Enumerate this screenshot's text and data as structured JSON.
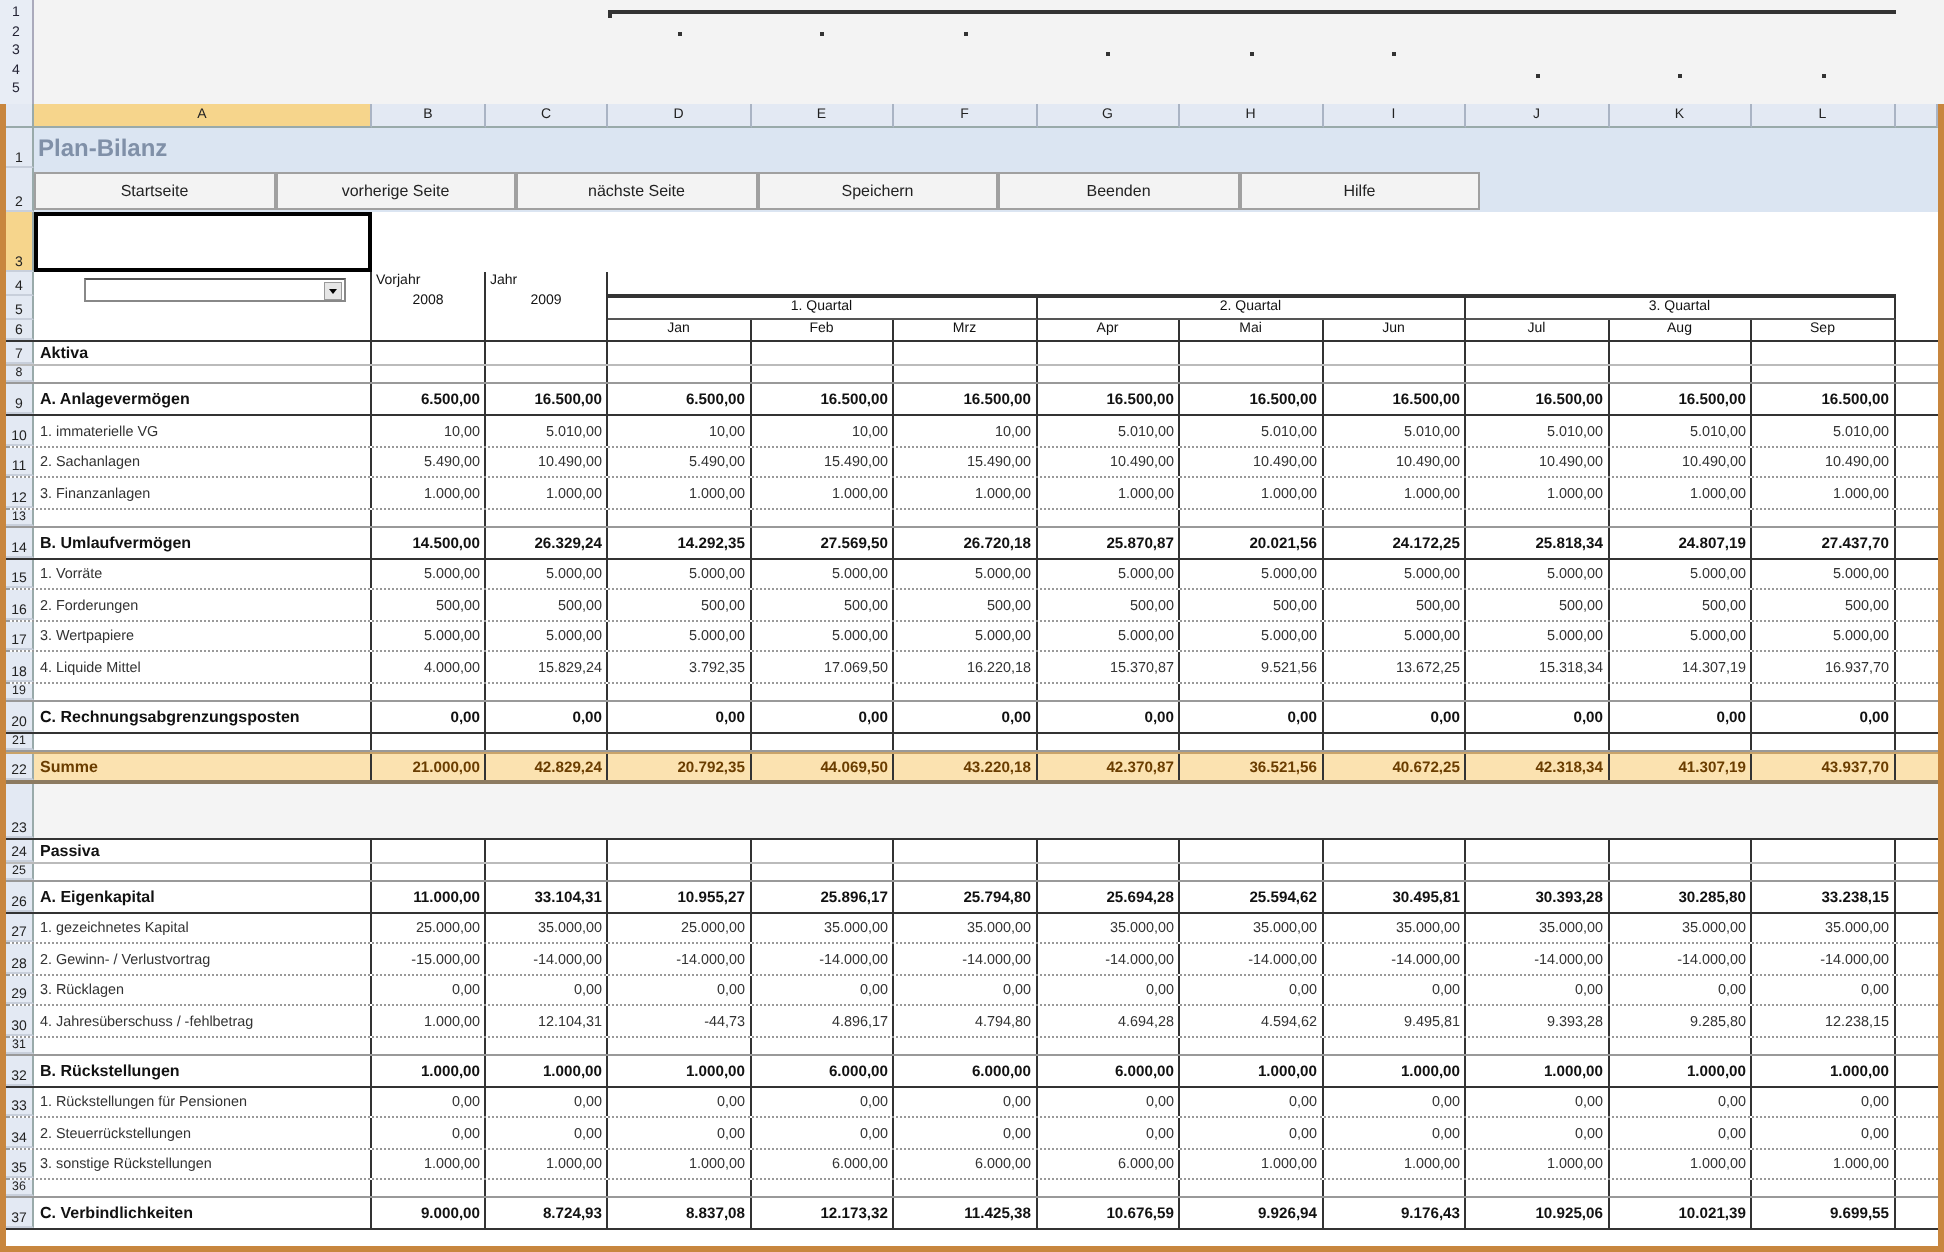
{
  "outline_levels": [
    "1",
    "2",
    "3",
    "4",
    "5"
  ],
  "columns": [
    {
      "letter": "A",
      "selected": true
    },
    {
      "letter": "B",
      "selected": false
    },
    {
      "letter": "C",
      "selected": false
    },
    {
      "letter": "D",
      "selected": false
    },
    {
      "letter": "E",
      "selected": false
    },
    {
      "letter": "F",
      "selected": false
    },
    {
      "letter": "G",
      "selected": false
    },
    {
      "letter": "H",
      "selected": false
    },
    {
      "letter": "I",
      "selected": false
    },
    {
      "letter": "J",
      "selected": false
    },
    {
      "letter": "K",
      "selected": false
    },
    {
      "letter": "L",
      "selected": false
    }
  ],
  "header_rows": [
    {
      "num": "1",
      "selected": false
    },
    {
      "num": "2",
      "selected": false
    },
    {
      "num": "3",
      "selected": true
    },
    {
      "num": "4",
      "selected": false
    },
    {
      "num": "5",
      "selected": false
    },
    {
      "num": "6",
      "selected": false
    }
  ],
  "title": "Plan-Bilanz",
  "buttons": [
    "Startseite",
    "vorherige Seite",
    "nächste Seite",
    "Speichern",
    "Beenden",
    "Hilfe"
  ],
  "years": [
    {
      "label": "Vorjahr",
      "year": "2008"
    },
    {
      "label": "Jahr",
      "year": "2009"
    }
  ],
  "quarters": [
    "1. Quartal",
    "2. Quartal",
    "3. Quartal"
  ],
  "months": [
    "Jan",
    "Feb",
    "Mrz",
    "Apr",
    "Mai",
    "Jun",
    "Jul",
    "Aug",
    "Sep"
  ],
  "rows": [
    {
      "num": "7",
      "kind": "section",
      "label": "Aktiva"
    },
    {
      "num": "8",
      "kind": "blank"
    },
    {
      "num": "9",
      "kind": "group",
      "label": "A. Anlagevermögen",
      "values": [
        "6.500,00",
        "16.500,00",
        "6.500,00",
        "16.500,00",
        "16.500,00",
        "16.500,00",
        "16.500,00",
        "16.500,00",
        "16.500,00",
        "16.500,00",
        "16.500,00"
      ]
    },
    {
      "num": "10",
      "kind": "item",
      "label": "1. immaterielle VG",
      "values": [
        "10,00",
        "5.010,00",
        "10,00",
        "10,00",
        "10,00",
        "5.010,00",
        "5.010,00",
        "5.010,00",
        "5.010,00",
        "5.010,00",
        "5.010,00"
      ]
    },
    {
      "num": "11",
      "kind": "item",
      "label": "2. Sachanlagen",
      "values": [
        "5.490,00",
        "10.490,00",
        "5.490,00",
        "15.490,00",
        "15.490,00",
        "10.490,00",
        "10.490,00",
        "10.490,00",
        "10.490,00",
        "10.490,00",
        "10.490,00"
      ]
    },
    {
      "num": "12",
      "kind": "item",
      "label": "3. Finanzanlagen",
      "values": [
        "1.000,00",
        "1.000,00",
        "1.000,00",
        "1.000,00",
        "1.000,00",
        "1.000,00",
        "1.000,00",
        "1.000,00",
        "1.000,00",
        "1.000,00",
        "1.000,00"
      ]
    },
    {
      "num": "13",
      "kind": "blank"
    },
    {
      "num": "14",
      "kind": "group",
      "label": "B. Umlaufvermögen",
      "values": [
        "14.500,00",
        "26.329,24",
        "14.292,35",
        "27.569,50",
        "26.720,18",
        "25.870,87",
        "20.021,56",
        "24.172,25",
        "25.818,34",
        "24.807,19",
        "27.437,70"
      ]
    },
    {
      "num": "15",
      "kind": "item",
      "label": "1. Vorräte",
      "values": [
        "5.000,00",
        "5.000,00",
        "5.000,00",
        "5.000,00",
        "5.000,00",
        "5.000,00",
        "5.000,00",
        "5.000,00",
        "5.000,00",
        "5.000,00",
        "5.000,00"
      ]
    },
    {
      "num": "16",
      "kind": "item",
      "label": "2. Forderungen",
      "values": [
        "500,00",
        "500,00",
        "500,00",
        "500,00",
        "500,00",
        "500,00",
        "500,00",
        "500,00",
        "500,00",
        "500,00",
        "500,00"
      ]
    },
    {
      "num": "17",
      "kind": "item",
      "label": "3. Wertpapiere",
      "values": [
        "5.000,00",
        "5.000,00",
        "5.000,00",
        "5.000,00",
        "5.000,00",
        "5.000,00",
        "5.000,00",
        "5.000,00",
        "5.000,00",
        "5.000,00",
        "5.000,00"
      ]
    },
    {
      "num": "18",
      "kind": "item",
      "label": "4. Liquide Mittel",
      "values": [
        "4.000,00",
        "15.829,24",
        "3.792,35",
        "17.069,50",
        "16.220,18",
        "15.370,87",
        "9.521,56",
        "13.672,25",
        "15.318,34",
        "14.307,19",
        "16.937,70"
      ]
    },
    {
      "num": "19",
      "kind": "blank"
    },
    {
      "num": "20",
      "kind": "group",
      "label": "C. Rechnungsabgrenzungsposten",
      "values": [
        "0,00",
        "0,00",
        "0,00",
        "0,00",
        "0,00",
        "0,00",
        "0,00",
        "0,00",
        "0,00",
        "0,00",
        "0,00"
      ]
    },
    {
      "num": "21",
      "kind": "blank"
    },
    {
      "num": "22",
      "kind": "total",
      "label": "Summe",
      "values": [
        "21.000,00",
        "42.829,24",
        "20.792,35",
        "44.069,50",
        "43.220,18",
        "42.370,87",
        "36.521,56",
        "40.672,25",
        "42.318,34",
        "41.307,19",
        "43.937,70"
      ]
    },
    {
      "num": "23",
      "kind": "gap"
    },
    {
      "num": "24",
      "kind": "section",
      "label": "Passiva"
    },
    {
      "num": "25",
      "kind": "blank"
    },
    {
      "num": "26",
      "kind": "group",
      "label": "A. Eigenkapital",
      "values": [
        "11.000,00",
        "33.104,31",
        "10.955,27",
        "25.896,17",
        "25.794,80",
        "25.694,28",
        "25.594,62",
        "30.495,81",
        "30.393,28",
        "30.285,80",
        "33.238,15"
      ]
    },
    {
      "num": "27",
      "kind": "item",
      "label": "1. gezeichnetes Kapital",
      "values": [
        "25.000,00",
        "35.000,00",
        "25.000,00",
        "35.000,00",
        "35.000,00",
        "35.000,00",
        "35.000,00",
        "35.000,00",
        "35.000,00",
        "35.000,00",
        "35.000,00"
      ]
    },
    {
      "num": "28",
      "kind": "item",
      "label": "2. Gewinn- / Verlustvortrag",
      "values": [
        "-15.000,00",
        "-14.000,00",
        "-14.000,00",
        "-14.000,00",
        "-14.000,00",
        "-14.000,00",
        "-14.000,00",
        "-14.000,00",
        "-14.000,00",
        "-14.000,00",
        "-14.000,00"
      ]
    },
    {
      "num": "29",
      "kind": "item",
      "label": "3. Rücklagen",
      "values": [
        "0,00",
        "0,00",
        "0,00",
        "0,00",
        "0,00",
        "0,00",
        "0,00",
        "0,00",
        "0,00",
        "0,00",
        "0,00"
      ]
    },
    {
      "num": "30",
      "kind": "item",
      "label": "4. Jahresüberschuss / -fehlbetrag",
      "values": [
        "1.000,00",
        "12.104,31",
        "-44,73",
        "4.896,17",
        "4.794,80",
        "4.694,28",
        "4.594,62",
        "9.495,81",
        "9.393,28",
        "9.285,80",
        "12.238,15"
      ]
    },
    {
      "num": "31",
      "kind": "blank"
    },
    {
      "num": "32",
      "kind": "group",
      "label": "B. Rückstellungen",
      "values": [
        "1.000,00",
        "1.000,00",
        "1.000,00",
        "6.000,00",
        "6.000,00",
        "6.000,00",
        "1.000,00",
        "1.000,00",
        "1.000,00",
        "1.000,00",
        "1.000,00"
      ]
    },
    {
      "num": "33",
      "kind": "item",
      "label": "1. Rückstellungen für Pensionen",
      "values": [
        "0,00",
        "0,00",
        "0,00",
        "0,00",
        "0,00",
        "0,00",
        "0,00",
        "0,00",
        "0,00",
        "0,00",
        "0,00"
      ]
    },
    {
      "num": "34",
      "kind": "item",
      "label": "2. Steuerrückstellungen",
      "values": [
        "0,00",
        "0,00",
        "0,00",
        "0,00",
        "0,00",
        "0,00",
        "0,00",
        "0,00",
        "0,00",
        "0,00",
        "0,00"
      ]
    },
    {
      "num": "35",
      "kind": "item",
      "label": "3. sonstige Rückstellungen",
      "values": [
        "1.000,00",
        "1.000,00",
        "1.000,00",
        "6.000,00",
        "6.000,00",
        "6.000,00",
        "1.000,00",
        "1.000,00",
        "1.000,00",
        "1.000,00",
        "1.000,00"
      ]
    },
    {
      "num": "36",
      "kind": "blank"
    },
    {
      "num": "37",
      "kind": "group",
      "label": "C. Verbindlichkeiten",
      "values": [
        "9.000,00",
        "8.724,93",
        "8.837,08",
        "12.173,32",
        "11.425,38",
        "10.676,59",
        "9.926,94",
        "9.176,43",
        "10.925,06",
        "10.021,39",
        "9.699,55"
      ]
    }
  ]
}
